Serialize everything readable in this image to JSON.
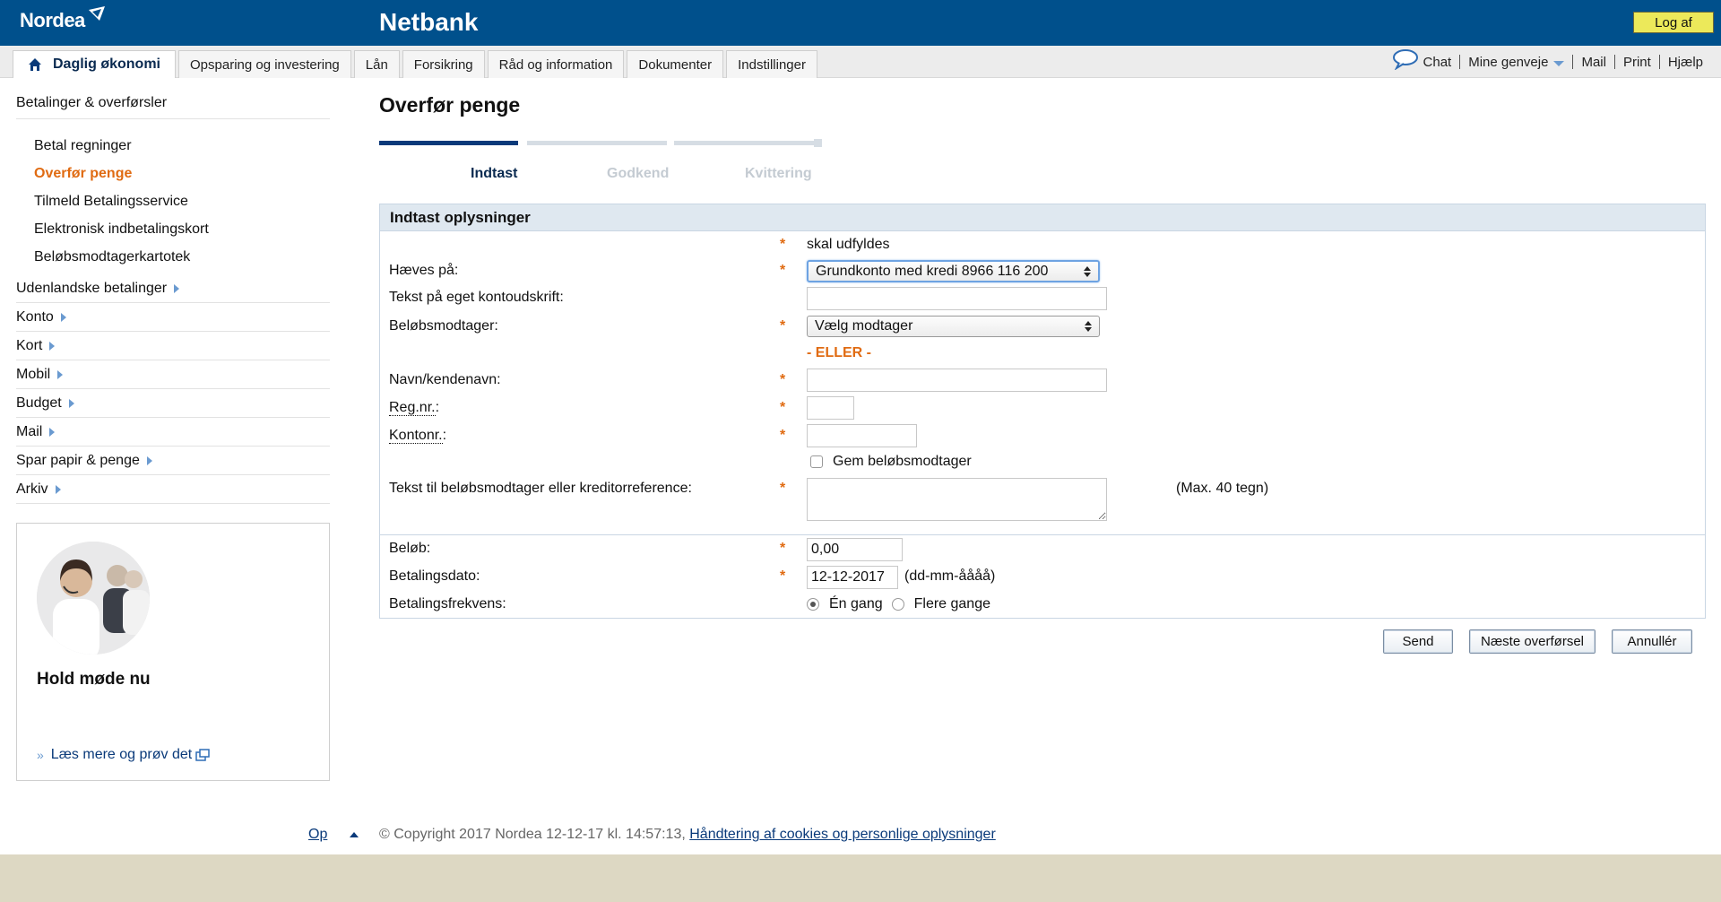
{
  "header": {
    "brand": "Nordea",
    "app_title": "Netbank",
    "logout_label": "Log af"
  },
  "tabs": [
    {
      "label": "Daglig økonomi",
      "active": true
    },
    {
      "label": "Opsparing og investering"
    },
    {
      "label": "Lån"
    },
    {
      "label": "Forsikring"
    },
    {
      "label": "Råd og information"
    },
    {
      "label": "Dokumenter"
    },
    {
      "label": "Indstillinger"
    }
  ],
  "utility_links": {
    "chat": "Chat",
    "shortcuts": "Mine genveje",
    "mail": "Mail",
    "print": "Print",
    "help": "Hjælp"
  },
  "sidebar": {
    "heading": "Betalinger & overførsler",
    "sub_items": [
      {
        "label": "Betal regninger"
      },
      {
        "label": "Overfør penge",
        "active": true
      },
      {
        "label": "Tilmeld Betalingsservice"
      },
      {
        "label": "Elektronisk indbetalingskort"
      },
      {
        "label": "Beløbsmodtagerkartotek"
      }
    ],
    "groups": [
      {
        "label": "Udenlandske betalinger"
      },
      {
        "label": "Konto"
      },
      {
        "label": "Kort"
      },
      {
        "label": "Mobil"
      },
      {
        "label": "Budget"
      },
      {
        "label": "Mail"
      },
      {
        "label": "Spar papir & penge"
      },
      {
        "label": "Arkiv"
      }
    ]
  },
  "promo": {
    "title": "Hold møde nu",
    "link": "Læs mere og prøv det"
  },
  "page": {
    "title": "Overfør penge",
    "steps": [
      "Indtast",
      "Godkend",
      "Kvittering"
    ],
    "active_step": 0
  },
  "form": {
    "heading": "Indtast oplysninger",
    "required_note": "skal udfyldes",
    "required_mark": "*",
    "debit_label": "Hæves på:",
    "debit_value": "Grundkonto med kredi 8966 116 200",
    "own_text_label": "Tekst på eget kontoudskrift:",
    "own_text_value": "",
    "recipient_label": "Beløbsmodtager:",
    "recipient_value": "Vælg modtager",
    "or_label": "- ELLER -",
    "name_label": "Navn/kendenavn:",
    "name_value": "",
    "reg_label": "Reg.nr.",
    "reg_value": "",
    "account_label": "Kontonr.",
    "account_value": "",
    "colon": ":",
    "save_recipient_label": "Gem beløbsmodtager",
    "message_label": "Tekst til beløbsmodtager eller kreditorreference:",
    "message_value": "",
    "message_hint": "(Max. 40 tegn)",
    "amount_label": "Beløb:",
    "amount_value": "0,00",
    "date_label": "Betalingsdato:",
    "date_value": "12-12-2017",
    "date_hint": "(dd-mm-åååå)",
    "frequency_label": "Betalingsfrekvens:",
    "frequency_once": "Én gang",
    "frequency_many": "Flere gange",
    "frequency_selected": "once"
  },
  "buttons": {
    "send": "Send",
    "next": "Næste overførsel",
    "cancel": "Annullér"
  },
  "footer": {
    "top_link": "Op",
    "copyright": "© Copyright 2017 Nordea 12-12-17 kl. 14:57:13,",
    "cookies_link": "Håndtering af cookies og personlige oplysninger"
  },
  "colors": {
    "brand_blue": "#00508c",
    "accent_orange": "#e06b12",
    "logout_yellow": "#ece95a",
    "form_header": "#dfe8f0"
  }
}
